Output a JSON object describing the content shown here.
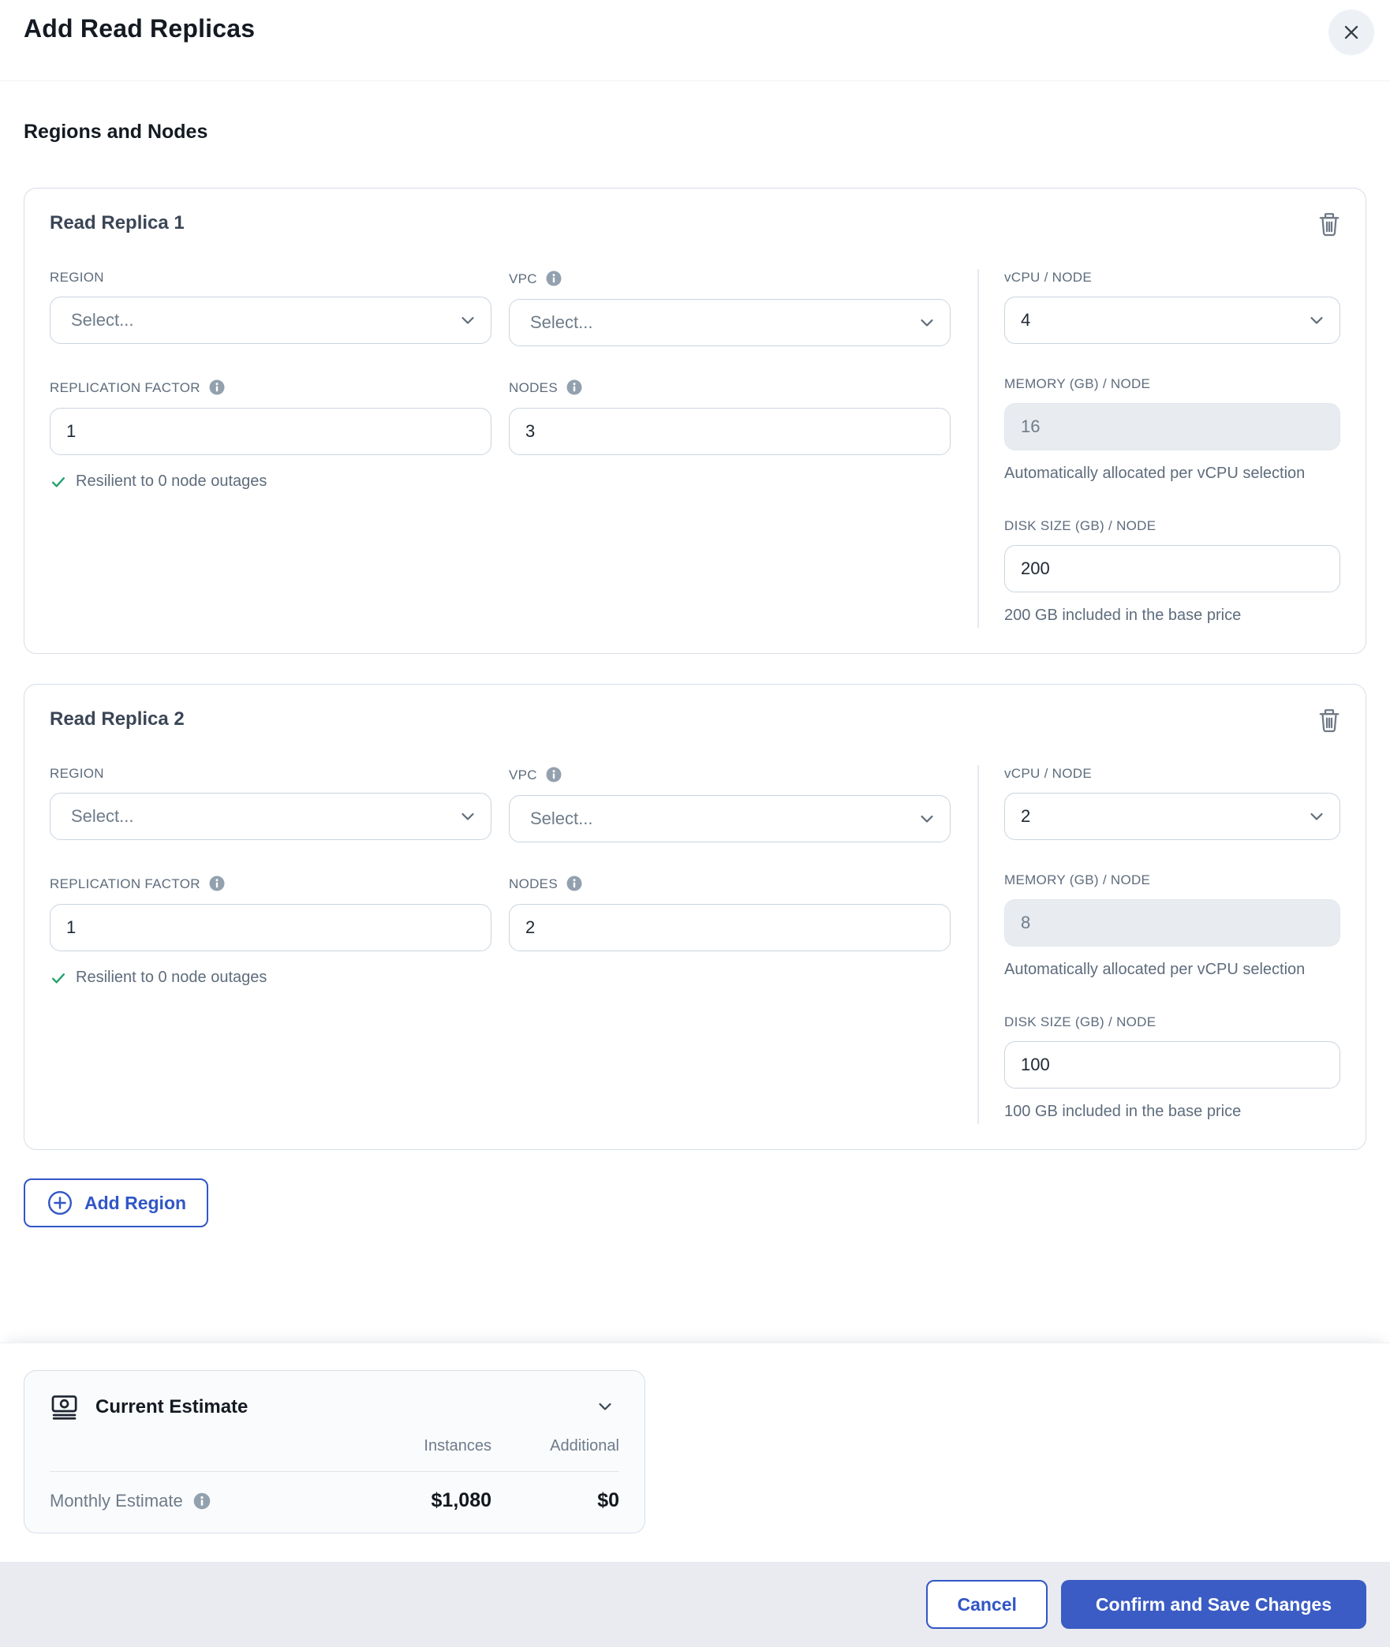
{
  "dialog": {
    "title": "Add Read Replicas"
  },
  "section_title": "Regions and Nodes",
  "replicas": [
    {
      "title": "Read Replica 1",
      "region": {
        "label": "REGION",
        "placeholder": "Select..."
      },
      "vpc": {
        "label": "VPC",
        "placeholder": "Select..."
      },
      "vcpu": {
        "label": "vCPU / NODE",
        "value": "4"
      },
      "replication_factor": {
        "label": "REPLICATION FACTOR",
        "value": "1"
      },
      "nodes": {
        "label": "NODES",
        "value": "3"
      },
      "memory": {
        "label": "MEMORY (GB) / NODE",
        "value": "16",
        "helper": "Automatically allocated per vCPU selection"
      },
      "disk": {
        "label": "DISK SIZE (GB) / NODE",
        "value": "200",
        "helper": "200 GB included in the base price"
      },
      "resilience_note": "Resilient to 0 node outages"
    },
    {
      "title": "Read Replica 2",
      "region": {
        "label": "REGION",
        "placeholder": "Select..."
      },
      "vpc": {
        "label": "VPC",
        "placeholder": "Select..."
      },
      "vcpu": {
        "label": "vCPU / NODE",
        "value": "2"
      },
      "replication_factor": {
        "label": "REPLICATION FACTOR",
        "value": "1"
      },
      "nodes": {
        "label": "NODES",
        "value": "2"
      },
      "memory": {
        "label": "MEMORY (GB) / NODE",
        "value": "8",
        "helper": "Automatically allocated per vCPU selection"
      },
      "disk": {
        "label": "DISK SIZE (GB) / NODE",
        "value": "100",
        "helper": "100 GB included in the base price"
      },
      "resilience_note": "Resilient to 0 node outages"
    }
  ],
  "add_region_label": "Add Region",
  "estimate": {
    "title": "Current Estimate",
    "columns": [
      "Instances",
      "Additional"
    ],
    "rows": [
      {
        "label": "Monthly Estimate",
        "instances": "$1,080",
        "additional": "$0"
      }
    ]
  },
  "footer": {
    "cancel_label": "Cancel",
    "confirm_label": "Confirm and Save Changes"
  },
  "colors": {
    "accent_blue": "#3156c6",
    "confirm_fill": "#3b5cc4",
    "success_green": "#23a26b",
    "footer_bg": "#e9ebf0"
  }
}
